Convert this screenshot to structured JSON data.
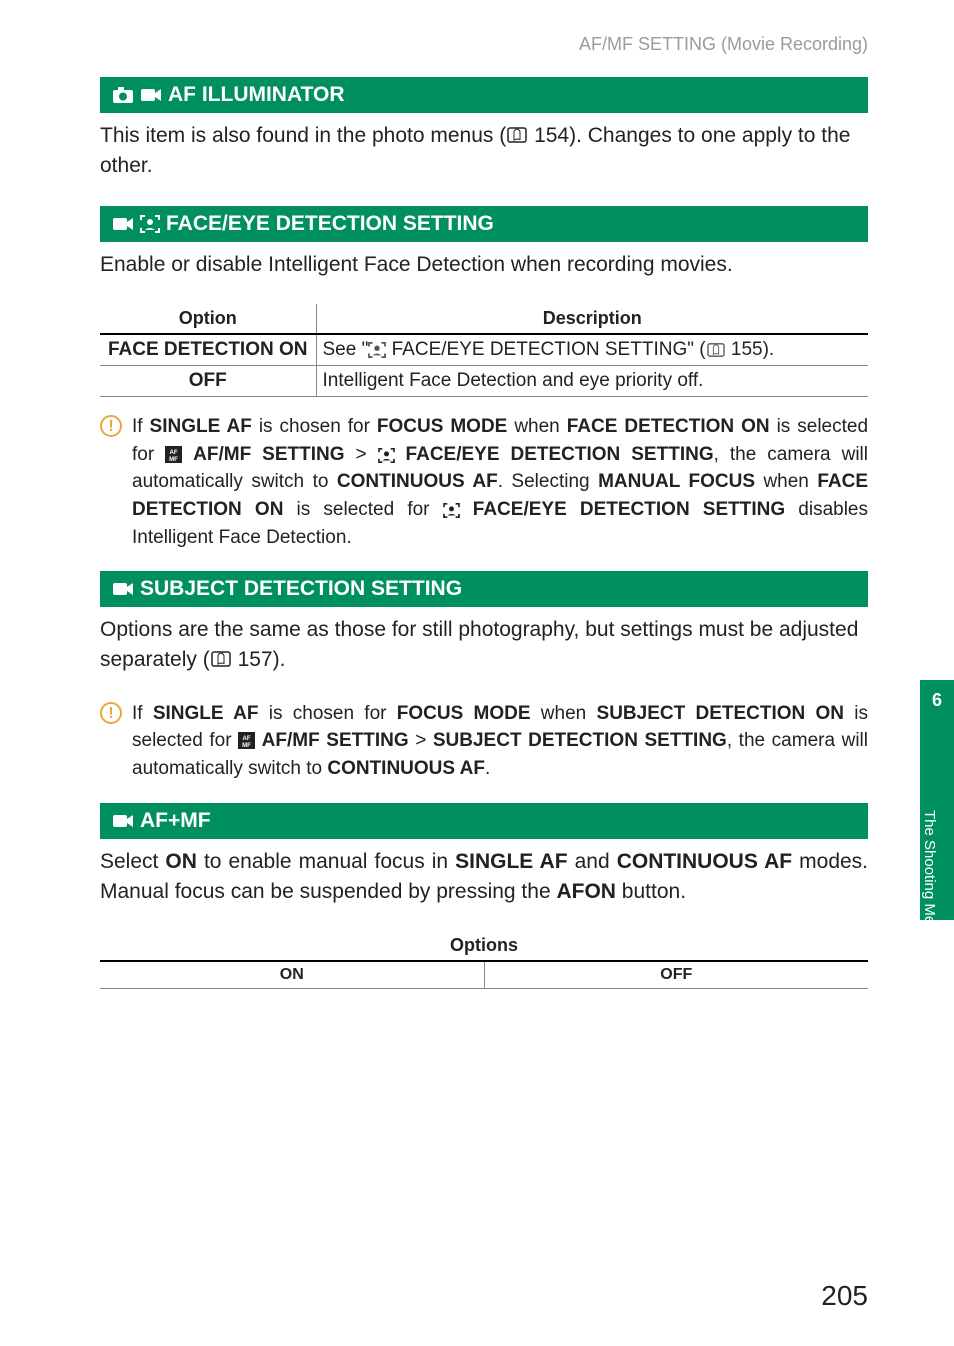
{
  "breadcrumb": "AF/MF SETTING (Movie Recording)",
  "sections": {
    "af_illuminator": {
      "title": "AF ILLUMINATOR",
      "body_before": "This item is also found in the photo menus (",
      "body_pageref": "154",
      "body_after": "). Changes to one apply to the other."
    },
    "face_eye": {
      "title": "FACE/EYE DETECTION SETTING",
      "intro": "Enable or disable Intelligent Face Detection when recording movies.",
      "table": {
        "head_option": "Option",
        "head_desc": "Description",
        "rows": [
          {
            "option": "FACE DETECTION ON",
            "desc_before": "See \"",
            "desc_link": "FACE/EYE DETECTION SETTING",
            "desc_page": "155",
            "desc_after": ")."
          },
          {
            "option": "OFF",
            "desc": "Intelligent Face Detection and eye priority off."
          }
        ]
      },
      "note_parts": {
        "p1": "If ",
        "single_af": "SINGLE AF",
        "p2": " is chosen for ",
        "focus_mode": "FOCUS MODE",
        "p3": " when ",
        "face_det_on1": "FACE DETECTION ON",
        "p4": " is selected for ",
        "afmf": "AF/MF SETTING",
        "gt": " > ",
        "fe1": "FACE/EYE DETECTION SETTING",
        "p5": ", the camera will automatically switch to ",
        "cont_af": "CONTINUOUS AF",
        "p6": ". Selecting ",
        "manual_focus": "MANUAL FOCUS",
        "p7": " when ",
        "face_det_on2": "FACE DETECTION ON",
        "p8": " is selected for ",
        "fe2": "FACE/EYE DETECTION SETTING",
        "p9": " disables Intelligent Face De­tection."
      }
    },
    "subject": {
      "title": "SUBJECT DETECTION SETTING",
      "body_before": "Options are the same as those for still photography, but settings must be adjusted separately (",
      "body_pageref": "157",
      "body_after": ").",
      "note_parts": {
        "p1": "If ",
        "single_af": "SINGLE AF",
        "p2": " is chosen for ",
        "focus_mode": "FOCUS MODE",
        "p3": " when ",
        "subj_on": "SUBJECT DETECTION ON",
        "p4": " is selected for ",
        "afmf": "AF/MF SETTING",
        "gt": " > ",
        "subj_set": "SUBJECT DETECTION SETTING",
        "p5": ", the camera will automatically switch to ",
        "cont_af": "CONTINUOUS AF",
        "p6": "."
      }
    },
    "afmf": {
      "title": "AF+MF",
      "body_parts": {
        "p1": "Select ",
        "on": "ON",
        "p2": " to enable manual focus in ",
        "single_af": "SINGLE AF",
        "p3": " and ",
        "cont_af": "CONTINUOUS AF",
        "p4": " modes. Manual focus can be suspended by pressing the ",
        "afon": "AFON",
        "p5": " button."
      },
      "options_head": "Options",
      "options": {
        "on": "ON",
        "off": "OFF"
      }
    }
  },
  "tab": {
    "num": "6",
    "label": "The Shooting Menus"
  },
  "page_number": "205"
}
